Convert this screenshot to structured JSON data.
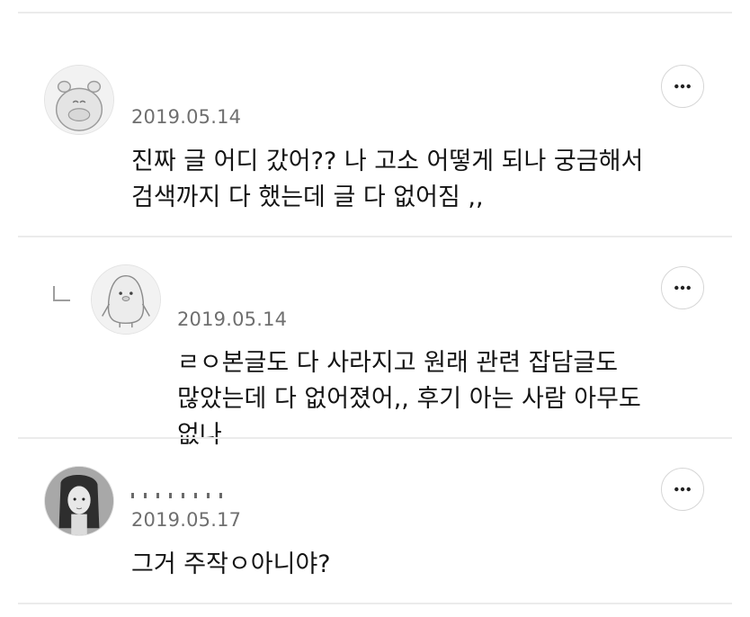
{
  "comments": [
    {
      "date": "2019.05.14",
      "text": "진짜 글 어디 갔어?? 나 고소 어떻게 되나 궁금해서 검색까지 다 했는데 글 다 없어짐 ,,"
    },
    {
      "date": "2019.05.14",
      "text": "ㄹㅇ본글도 다 사라지고 원래 관련 잡담글도 많았는데 다 없어졌어,, 후기 아는 사람 아무도 없나"
    },
    {
      "date": "2019.05.17",
      "text": "그거 주작ㅇ아니야?"
    }
  ],
  "icons": {
    "more": "more-options-icon",
    "reply": "reply-indicator-icon"
  }
}
